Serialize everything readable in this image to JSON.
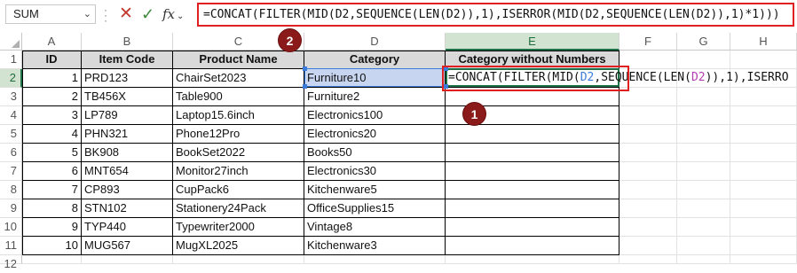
{
  "formula_bar": {
    "name_box": "SUM",
    "fx_label": "fx",
    "formula": "=CONCAT(FILTER(MID(D2,SEQUENCE(LEN(D2)),1),ISERROR(MID(D2,SEQUENCE(LEN(D2)),1)*1)))"
  },
  "columns": [
    "A",
    "B",
    "C",
    "D",
    "E",
    "F",
    "G",
    "H"
  ],
  "rows": [
    "1",
    "2",
    "3",
    "4",
    "5",
    "6",
    "7",
    "8",
    "9",
    "10",
    "11",
    "12"
  ],
  "table": {
    "headers": [
      "ID",
      "Item Code",
      "Product Name",
      "Category",
      "Category without Numbers"
    ],
    "rows": [
      [
        "1",
        "PRD123",
        "ChairSet2023",
        "Furniture10"
      ],
      [
        "2",
        "TB456X",
        "Table900",
        "Furniture2"
      ],
      [
        "3",
        "LP789",
        "Laptop15.6inch",
        "Electronics100"
      ],
      [
        "4",
        "PHN321",
        "Phone12Pro",
        "Electronics20"
      ],
      [
        "5",
        "BK908",
        "BookSet2022",
        "Books50"
      ],
      [
        "6",
        "MNT654",
        "Monitor27inch",
        "Electronics30"
      ],
      [
        "7",
        "CP893",
        "CupPack6",
        "Kitchenware5"
      ],
      [
        "8",
        "STN102",
        "Stationery24Pack",
        "OfficeSupplies15"
      ],
      [
        "9",
        "TYP440",
        "Typewriter2000",
        "Vintage8"
      ],
      [
        "10",
        "MUG567",
        "MugXL2025",
        "Kitchenware3"
      ]
    ]
  },
  "edit_cell": {
    "parts": [
      "=CONCAT(FILTER(MID(",
      "D2",
      ",SEQUENCE(LEN(",
      "D2",
      ")),1),ISERRO"
    ]
  },
  "callouts": [
    "1",
    "2"
  ],
  "colors": {
    "callout_border": "#e02020",
    "badge": "#8b1a1a",
    "ref_highlight": "#c7d5f0",
    "ref_blue": "#3b7bd9",
    "selection_green": "#1e7145",
    "header_fill": "#d9d9d9"
  }
}
